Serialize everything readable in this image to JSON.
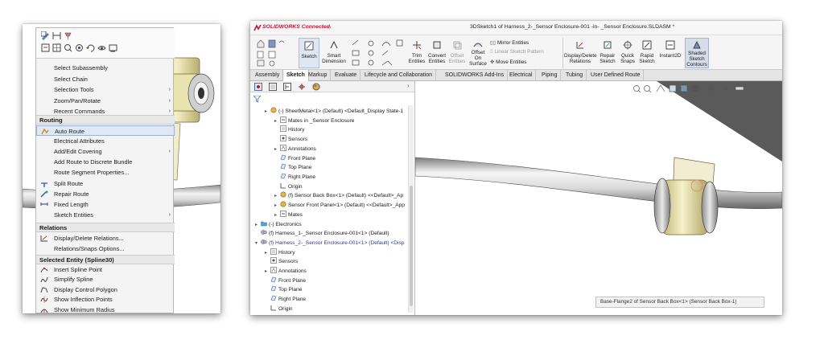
{
  "context_menu": {
    "items_top": [
      {
        "label": "Select Subassembly",
        "icon": ""
      },
      {
        "label": "Select Chain",
        "icon": ""
      },
      {
        "label": "Selection Tools",
        "icon": "",
        "submenu": true
      },
      {
        "label": "Zoom/Pan/Rotate",
        "icon": "",
        "submenu": true
      },
      {
        "label": "Recent Commands",
        "icon": "",
        "submenu": true
      }
    ],
    "routing_header": "Routing",
    "items_routing": [
      {
        "label": "Auto Route",
        "icon": "auto-route-icon",
        "highlighted": true
      },
      {
        "label": "Electrical Attributes",
        "icon": ""
      },
      {
        "label": "Add/Edit Covering",
        "icon": "",
        "submenu": true
      },
      {
        "label": "Add Route to Discrete Bundle",
        "icon": ""
      },
      {
        "label": "Route Segment Properties...",
        "icon": ""
      },
      {
        "label": "Split Route",
        "icon": "split-route-icon"
      },
      {
        "label": "Repair Route",
        "icon": "repair-route-icon"
      },
      {
        "label": "Fixed Length",
        "icon": "fixed-length-icon"
      },
      {
        "label": "Sketch Entities",
        "icon": "",
        "submenu": true
      }
    ],
    "relations_header": "Relations",
    "items_relations": [
      {
        "label": "Display/Delete Relations...",
        "icon": "relations-icon"
      },
      {
        "label": "Relations/Snaps Options...",
        "icon": ""
      }
    ],
    "selected_header": "Selected Entity (Spline30)",
    "items_selected": [
      {
        "label": "Insert Spline Point",
        "icon": "insert-spline-point-icon"
      },
      {
        "label": "Simplify Spline",
        "icon": "simplify-spline-icon"
      },
      {
        "label": "Display Control Polygon",
        "icon": "control-polygon-icon"
      },
      {
        "label": "Show Inflection Points",
        "icon": "inflection-points-icon"
      },
      {
        "label": "Show Minimum Radius",
        "icon": "minimum-radius-icon"
      }
    ]
  },
  "window": {
    "brand": "SOLIDWORKS Connected",
    "title": "3DSketch1 of Harness_2-_Sensor Enclosure-001 -in- _Sensor Enclosure.SLDASM *"
  },
  "ribbon": {
    "sketch": "Sketch",
    "smart_dimension_1": "Smart",
    "smart_dimension_2": "Dimension",
    "trim_1": "Trim",
    "trim_2": "Entities",
    "convert_1": "Convert",
    "convert_2": "Entities",
    "offset_1": "Offset",
    "offset_2": "Entities",
    "offset_surface_1": "Offset",
    "offset_surface_2": "On",
    "offset_surface_3": "Surface",
    "mirror": "Mirror Entities",
    "linear_pattern": "Linear Sketch Pattern",
    "move": "Move Entities",
    "display_delete_1": "Display/Delete",
    "display_delete_2": "Relations",
    "repair_1": "Repair",
    "repair_2": "Sketch",
    "quick_snaps_1": "Quick",
    "quick_snaps_2": "Snaps",
    "rapid_sketch_1": "Rapid",
    "rapid_sketch_2": "Sketch",
    "instant2d": "Instant2D",
    "shaded_1": "Shaded",
    "shaded_2": "Sketch",
    "shaded_3": "Contours"
  },
  "tabs": [
    "Assembly",
    "Sketch",
    "Markup",
    "Evaluate",
    "Lifecycle and Collaboration",
    "SOLIDWORKS Add-Ins",
    "Electrical",
    "Piping",
    "Tubing",
    "User Defined Route"
  ],
  "active_tab": "Sketch",
  "tree": [
    {
      "label": "(-) SheetMetal<1> (Default) <Default_Display State-1",
      "indent": 1,
      "expand": "▸",
      "icon": "part-icon"
    },
    {
      "label": "Mates in _Sensor Enclosure",
      "indent": 2,
      "expand": "▸",
      "icon": "mates-icon"
    },
    {
      "label": "History",
      "indent": 2,
      "expand": "",
      "icon": "history-icon"
    },
    {
      "label": "Sensors",
      "indent": 2,
      "expand": "",
      "icon": "sensors-icon"
    },
    {
      "label": "Annotations",
      "indent": 2,
      "expand": "▸",
      "icon": "annotations-icon"
    },
    {
      "label": "Front Plane",
      "indent": 2,
      "expand": "",
      "icon": "plane-icon"
    },
    {
      "label": "Top Plane",
      "indent": 2,
      "expand": "",
      "icon": "plane-icon"
    },
    {
      "label": "Right Plane",
      "indent": 2,
      "expand": "",
      "icon": "plane-icon"
    },
    {
      "label": "Origin",
      "indent": 2,
      "expand": "",
      "icon": "origin-icon"
    },
    {
      "label": "(f) Sensor Back Box<1> (Default) <<Default>_Ap",
      "indent": 2,
      "expand": "▸",
      "icon": "part-icon"
    },
    {
      "label": "Sensor Front Panel<1> (Default) <<Default>_App",
      "indent": 2,
      "expand": "▸",
      "icon": "part-icon"
    },
    {
      "label": "Mates",
      "indent": 2,
      "expand": "▸",
      "icon": "mates-icon"
    },
    {
      "label": "(-) Electronics",
      "indent": 0,
      "expand": "▸",
      "icon": "folder-icon"
    },
    {
      "label": "(f) Harness_1-_Sensor Enclosure-001<1> (Default)",
      "indent": 0,
      "expand": "",
      "icon": "assembly-icon"
    },
    {
      "label": "(f) Harness_2-_Sensor Enclosure-001<1> (Default) <Disp",
      "indent": 0,
      "expand": "▾",
      "icon": "assembly-icon",
      "active": true
    },
    {
      "label": "History",
      "indent": 1,
      "expand": "▸",
      "icon": "history-icon"
    },
    {
      "label": "Sensors",
      "indent": 1,
      "expand": "",
      "icon": "sensors-icon"
    },
    {
      "label": "Annotations",
      "indent": 1,
      "expand": "▸",
      "icon": "annotations-icon"
    },
    {
      "label": "Front Plane",
      "indent": 1,
      "expand": "",
      "icon": "plane-icon"
    },
    {
      "label": "Top Plane",
      "indent": 1,
      "expand": "",
      "icon": "plane-icon"
    },
    {
      "label": "Right Plane",
      "indent": 1,
      "expand": "",
      "icon": "plane-icon"
    },
    {
      "label": "Origin",
      "indent": 1,
      "expand": "",
      "icon": "origin-icon"
    }
  ],
  "status_tooltip": "Base-Flange2 of Sensor Back Box<1> (Sensor Back Box-1)",
  "colors": {
    "accent": "#c8102e",
    "tab_active": "#ffffff",
    "highlight": "#dfe8f4",
    "tree_active": "#2a3b8f"
  }
}
